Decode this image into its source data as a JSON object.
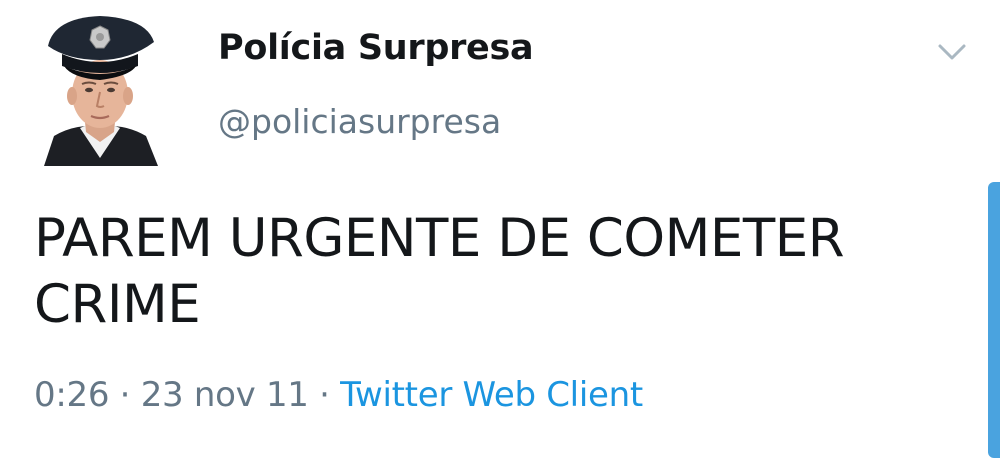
{
  "tweet": {
    "display_name": "Polícia Surpresa",
    "handle": "@policiasurpresa",
    "text_line1": "PAREM URGENTE DE COMETER",
    "text_line2": "CRIME",
    "time": "0:26",
    "separator1": " · ",
    "date": "23 nov 11",
    "separator2": " · ",
    "source": "Twitter Web Client"
  },
  "icons": {
    "avatar": "police-officer-avatar",
    "caret": "chevron-down-icon"
  },
  "colors": {
    "text": "#14171a",
    "secondary": "#657786",
    "link": "#1b95e0",
    "scrollbar": "#4aa3df"
  }
}
